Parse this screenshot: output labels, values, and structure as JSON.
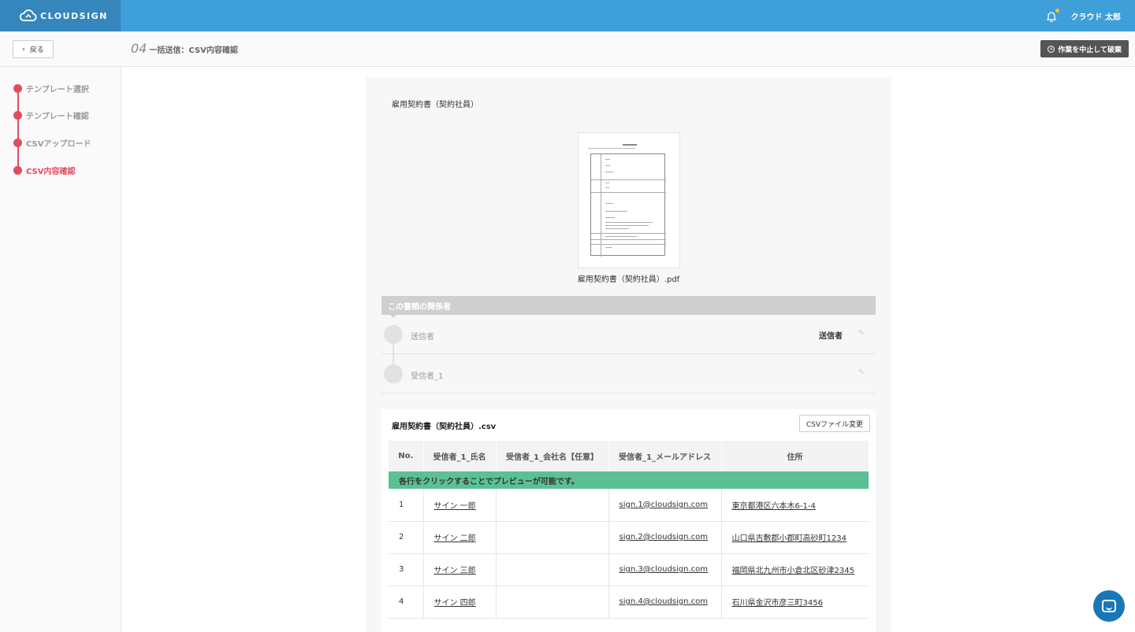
{
  "header": {
    "logo_text": "CLOUDSIGN",
    "user_name": "クラウド 太郎",
    "notification_dot_color": "#f5c518"
  },
  "subheader": {
    "back_label": "戻る",
    "step_number": "04",
    "step_title": "一括送信：CSV内容確認",
    "discard_label": "作業を中止して破棄"
  },
  "sidebar": {
    "steps": [
      {
        "label": "テンプレート選択"
      },
      {
        "label": "テンプレート確認"
      },
      {
        "label": "CSVアップロード"
      },
      {
        "label": "CSV内容確認"
      }
    ]
  },
  "document": {
    "title": "雇用契約書（契約社員）",
    "pdf_name": "雇用契約書（契約社員）.pdf"
  },
  "relations": {
    "header": "この書類の関係者",
    "rows": [
      {
        "label": "送信者",
        "value": "送信者"
      },
      {
        "label": "受信者_1",
        "value": ""
      }
    ]
  },
  "csv": {
    "file_name": "雇用契約書（契約社員）.csv",
    "change_button": "CSVファイル変更",
    "columns": [
      "No.",
      "受信者_1_氏名",
      "受信者_1_会社名【任意】",
      "受信者_1_メールアドレス",
      "住所"
    ],
    "notice": "各行をクリックすることでプレビューが可能です。",
    "rows": [
      {
        "no": "1",
        "name": "サイン 一郎",
        "company": "",
        "email": "sign.1@cloudsign.com",
        "address": "東京都港区六本木6-1-4"
      },
      {
        "no": "2",
        "name": "サイン 二郎",
        "company": "",
        "email": "sign.2@cloudsign.com",
        "address": "山口県吉敷郡小郡町高砂町1234"
      },
      {
        "no": "3",
        "name": "サイン 三郎",
        "company": "",
        "email": "sign.3@cloudsign.com",
        "address": "福岡県北九州市小倉北区砂津2345"
      },
      {
        "no": "4",
        "name": "サイン 四郎",
        "company": "",
        "email": "sign.4@cloudsign.com",
        "address": "石川県金沢市彦三町3456"
      }
    ]
  },
  "colors": {
    "topbar": "#3e9fd9",
    "accent_red": "#e04c5e",
    "notice_green": "#5bc194",
    "chat_blue": "#1a77b7"
  }
}
